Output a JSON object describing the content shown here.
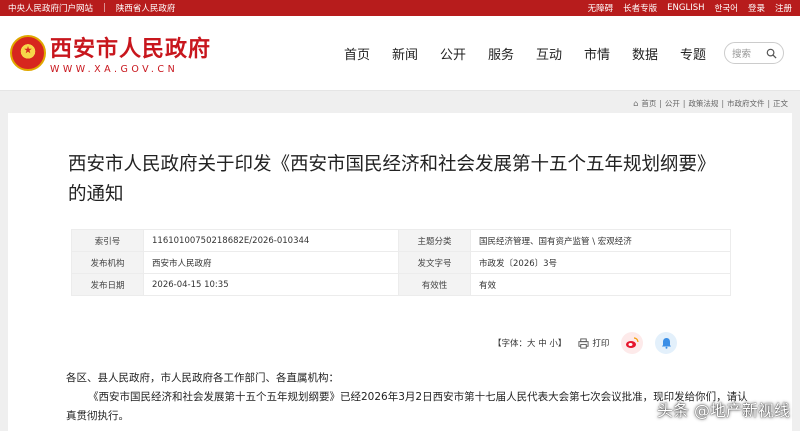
{
  "topbar": {
    "left": [
      "中央人民政府门户网站",
      "陕西省人民政府"
    ],
    "right": [
      "无障碍",
      "长者专版",
      "ENGLISH",
      "한국어",
      "登录",
      "注册"
    ]
  },
  "logo": {
    "cn": "西安市人民政府",
    "en": "WWW.XA.GOV.CN"
  },
  "nav": [
    "首页",
    "新闻",
    "公开",
    "服务",
    "互动",
    "市情",
    "数据",
    "专题"
  ],
  "search": {
    "placeholder": "搜索"
  },
  "breadcrumb": [
    "首页",
    "公开",
    "政策法规",
    "市政府文件",
    "正文"
  ],
  "article": {
    "title": "西安市人民政府关于印发《西安市国民经济和社会发展第十五个五年规划纲要》的通知",
    "meta": [
      {
        "k1": "索引号",
        "v1": "116101007502186​82E/2026-010344",
        "k2": "主题分类",
        "v2": "国民经济管理、国有资产监管 \\ 宏观经济"
      },
      {
        "k1": "发布机构",
        "v1": "西安市人民政府",
        "k2": "发文字号",
        "v2": "市政发〔2026〕3号"
      },
      {
        "k1": "发布日期",
        "v1": "2026-04-15 10:35",
        "k2": "有效性",
        "v2": "有效"
      }
    ],
    "font_tool": "【字体：大 中 小】",
    "print": "打印",
    "salutation": "各区、县人民政府，市人民政府各工作部门、各直属机构：",
    "paragraph": "《西安市国民经济和社会发展第十五个五年规划纲要》已经2026年3月2日西安市第十七届人民代表大会第七次会议批准，现印发给你们，请认真贯彻执行。"
  },
  "watermark": "头条 @地产新视线",
  "colors": {
    "brand_red": "#c8161d",
    "topbar_red": "#b71c1c"
  }
}
